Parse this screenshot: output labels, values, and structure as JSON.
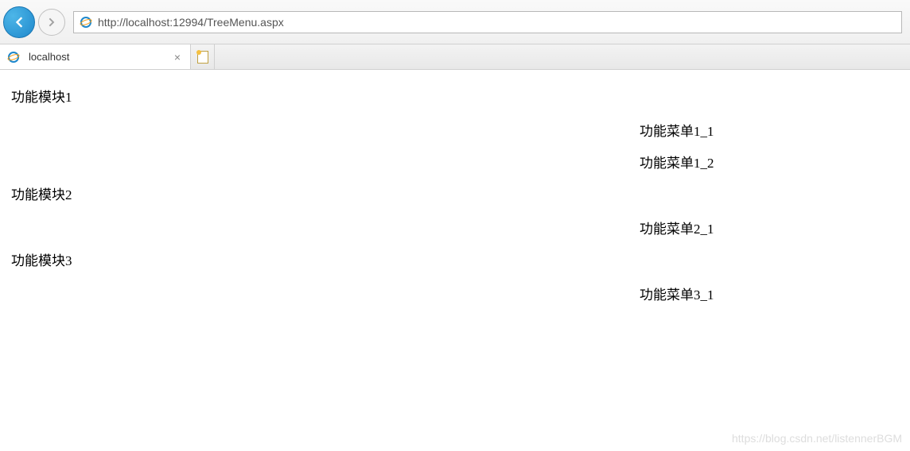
{
  "browser": {
    "url_display": "http://localhost:12994/TreeMenu.aspx",
    "tab_title": "localhost"
  },
  "page": {
    "modules": [
      {
        "title": "功能模块1",
        "menus": [
          "功能菜单1_1",
          "功能菜单1_2"
        ]
      },
      {
        "title": "功能模块2",
        "menus": [
          "功能菜单2_1"
        ]
      },
      {
        "title": "功能模块3",
        "menus": [
          "功能菜单3_1"
        ]
      }
    ]
  },
  "watermark": "https://blog.csdn.net/listennerBGM"
}
